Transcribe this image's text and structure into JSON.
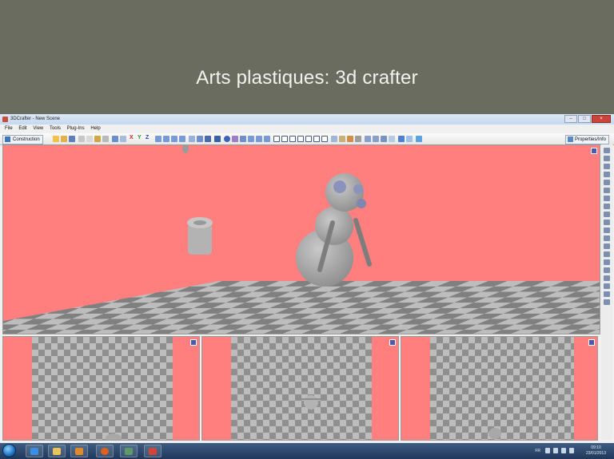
{
  "slide": {
    "title": "Arts plastiques: 3d crafter"
  },
  "window": {
    "title": "3DCrafter - New Scene",
    "controls": [
      "–",
      "□",
      "×"
    ]
  },
  "menu": [
    "File",
    "Edit",
    "View",
    "Tools",
    "Plug-Ins",
    "Help"
  ],
  "toolbar": {
    "construction_label": "Construction",
    "properties_label": "Properties/Info",
    "axes": [
      "X",
      "Y",
      "Z"
    ]
  },
  "viewports": {
    "main": {
      "background": "#ff7f7f",
      "floor": "checkerboard",
      "objects": [
        "snowman",
        "cup"
      ]
    },
    "subs": [
      {
        "name": "view-left"
      },
      {
        "name": "view-middle"
      },
      {
        "name": "view-right"
      }
    ]
  },
  "taskbar": {
    "apps": [
      "ie-icon",
      "explorer-icon",
      "media-player-icon",
      "firefox-icon",
      "network-app-icon",
      "3dcrafter-icon"
    ],
    "language": "FR",
    "time": "09:10",
    "date": "23/01/2013"
  },
  "colors": {
    "slide_bg": "#6b6c60",
    "viewport_bg": "#ff7f7f",
    "checker_dark": "#8f8f8f",
    "checker_light": "#bdbdbd"
  }
}
